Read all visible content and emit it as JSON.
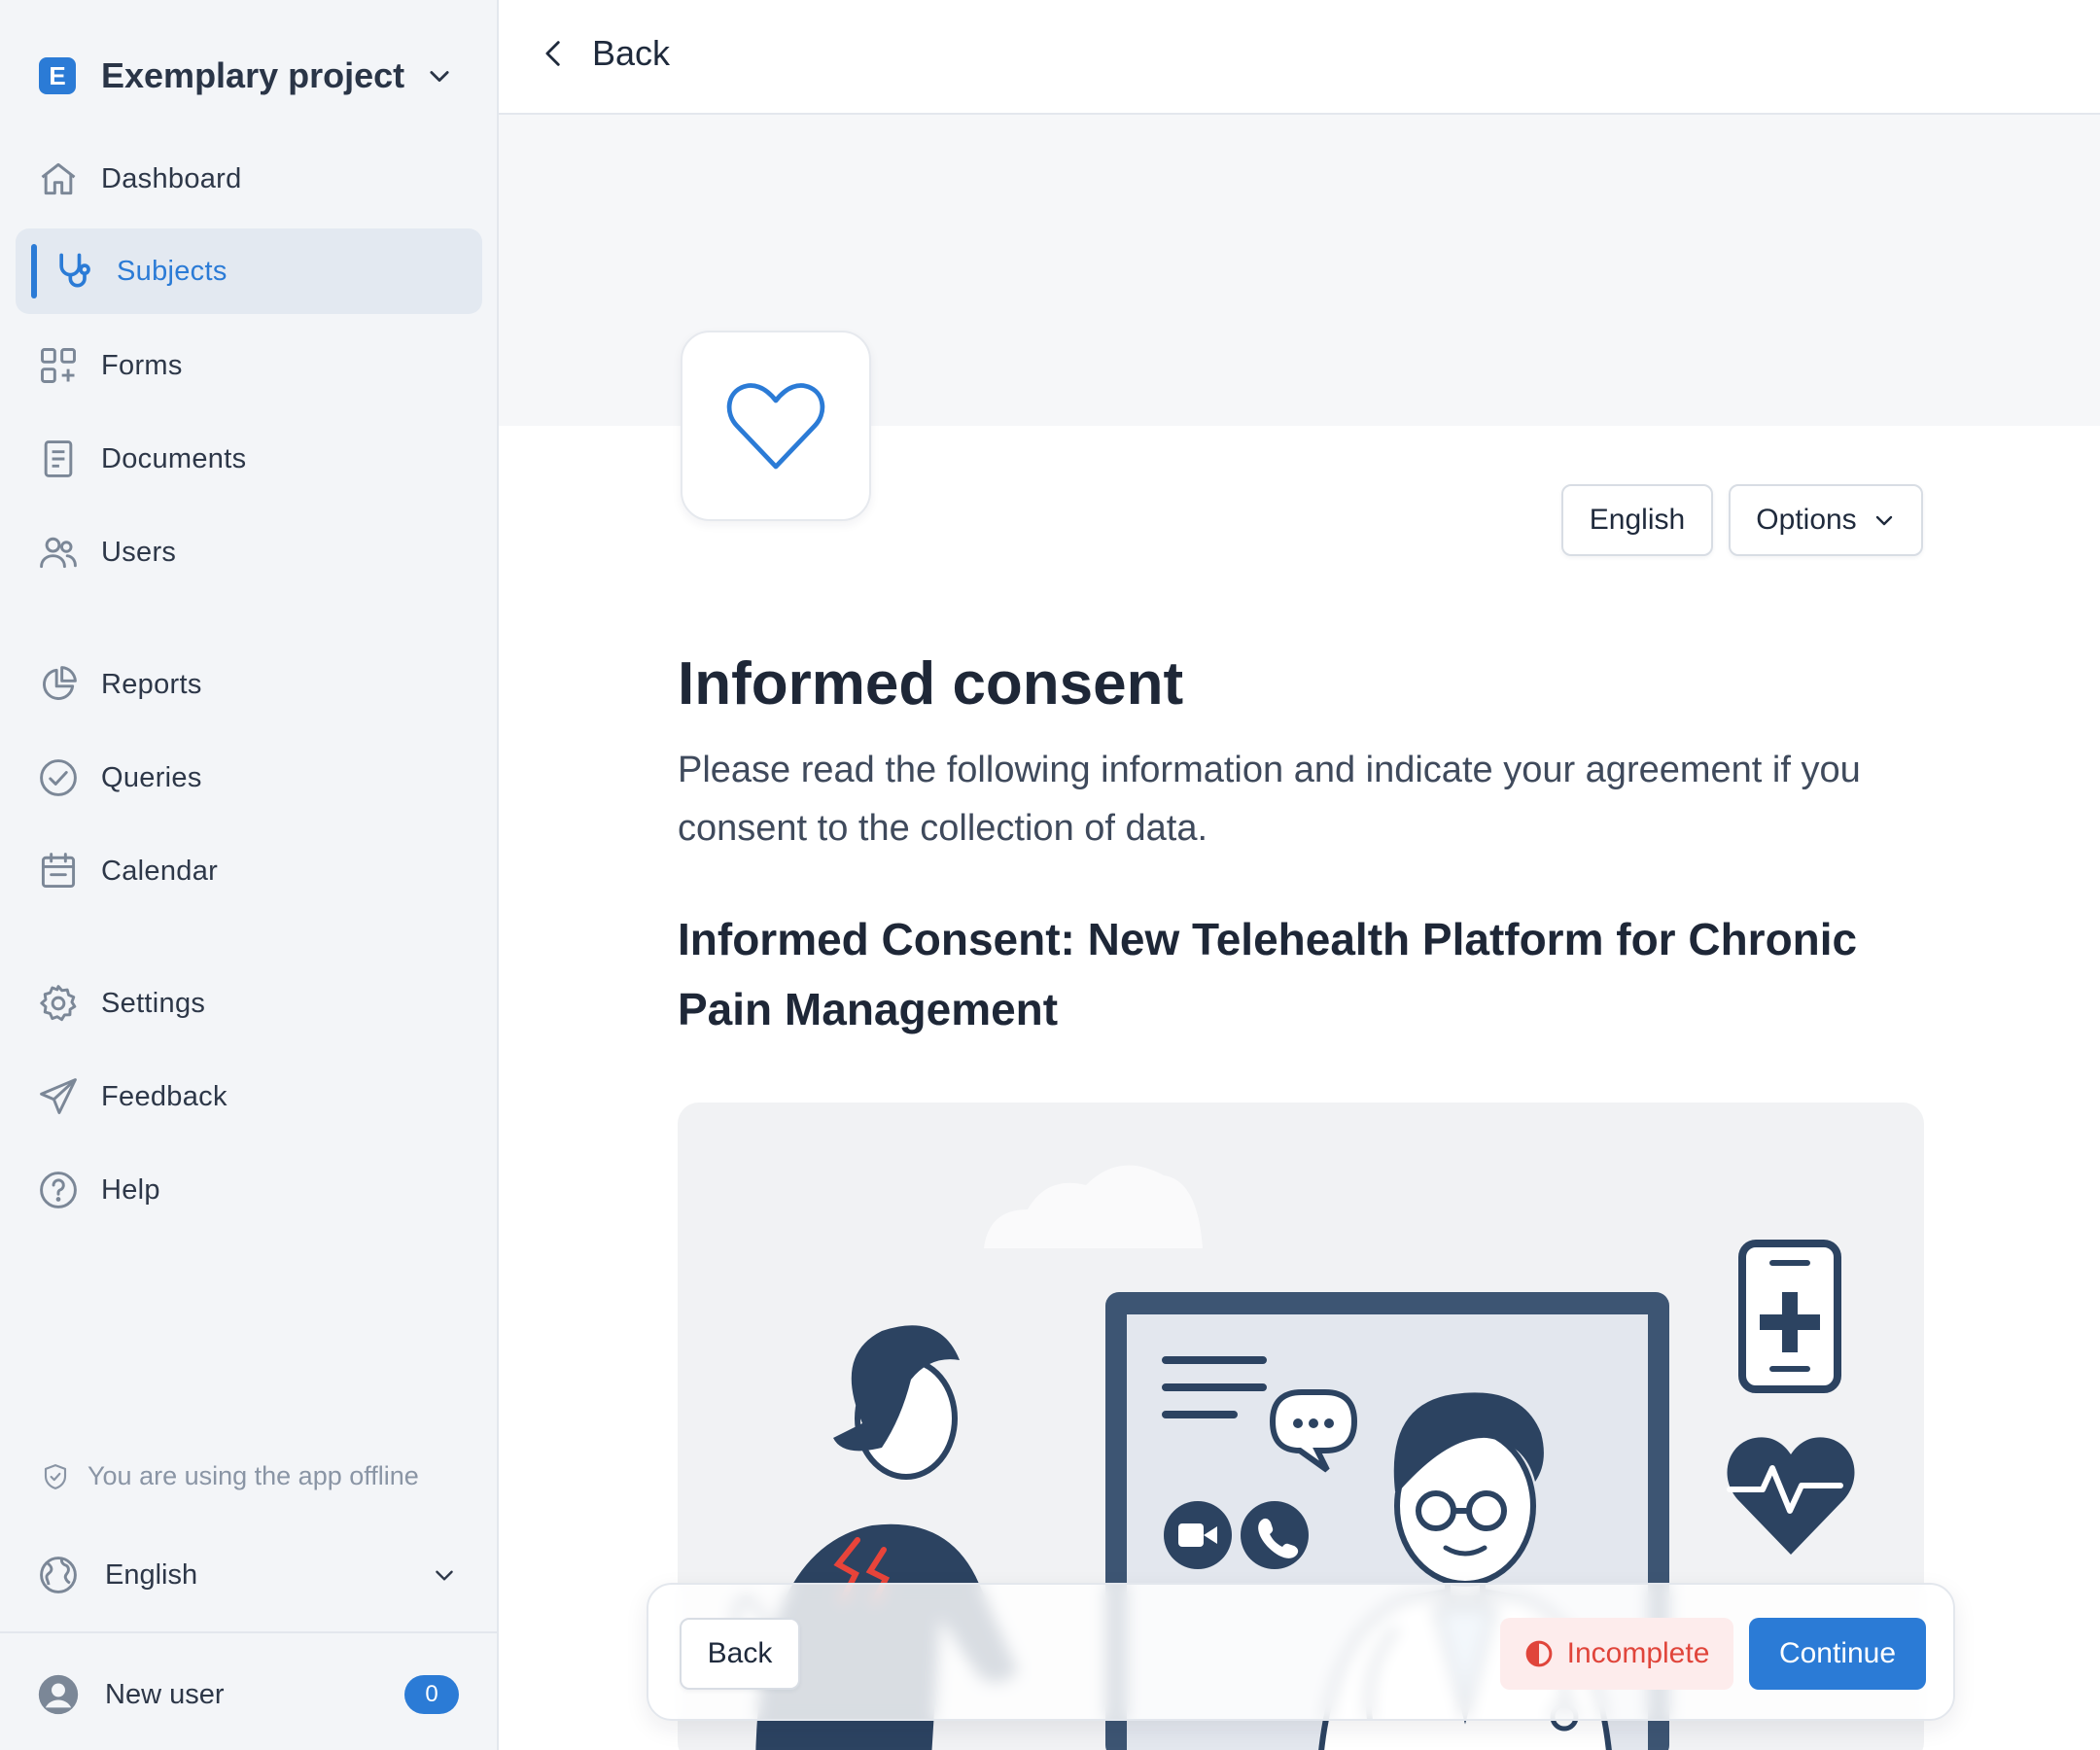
{
  "project": {
    "badge": "E",
    "name": "Exemplary project"
  },
  "sidebar": {
    "items": [
      {
        "label": "Dashboard",
        "icon": "home-icon"
      },
      {
        "label": "Subjects",
        "icon": "stethoscope-icon",
        "active": true
      },
      {
        "label": "Forms",
        "icon": "grid-plus-icon"
      },
      {
        "label": "Documents",
        "icon": "document-icon"
      },
      {
        "label": "Users",
        "icon": "users-icon"
      },
      {
        "label": "Reports",
        "icon": "pie-chart-icon"
      },
      {
        "label": "Queries",
        "icon": "check-circle-icon"
      },
      {
        "label": "Calendar",
        "icon": "calendar-icon"
      },
      {
        "label": "Settings",
        "icon": "gear-icon"
      },
      {
        "label": "Feedback",
        "icon": "paper-plane-icon"
      },
      {
        "label": "Help",
        "icon": "question-circle-icon"
      }
    ],
    "offline_text": "You are using the app offline",
    "language": "English",
    "user": {
      "name": "New user",
      "count": "0"
    }
  },
  "topbar": {
    "back_label": "Back"
  },
  "content": {
    "language_button": "English",
    "options_button": "Options",
    "title": "Informed consent",
    "intro": "Please read the following information and indicate your agreement if you consent to the collection of data.",
    "subtitle": "Informed Consent: New Telehealth Platform for Chronic Pain Management"
  },
  "footer": {
    "back_label": "Back",
    "status_label": "Incomplete",
    "continue_label": "Continue"
  },
  "colors": {
    "accent": "#2b7bd6",
    "sidebar_bg": "#f3f5f8",
    "incomplete_text": "#e0453b",
    "incomplete_bg": "#fdecec",
    "illustration_navy": "#2c4361"
  }
}
